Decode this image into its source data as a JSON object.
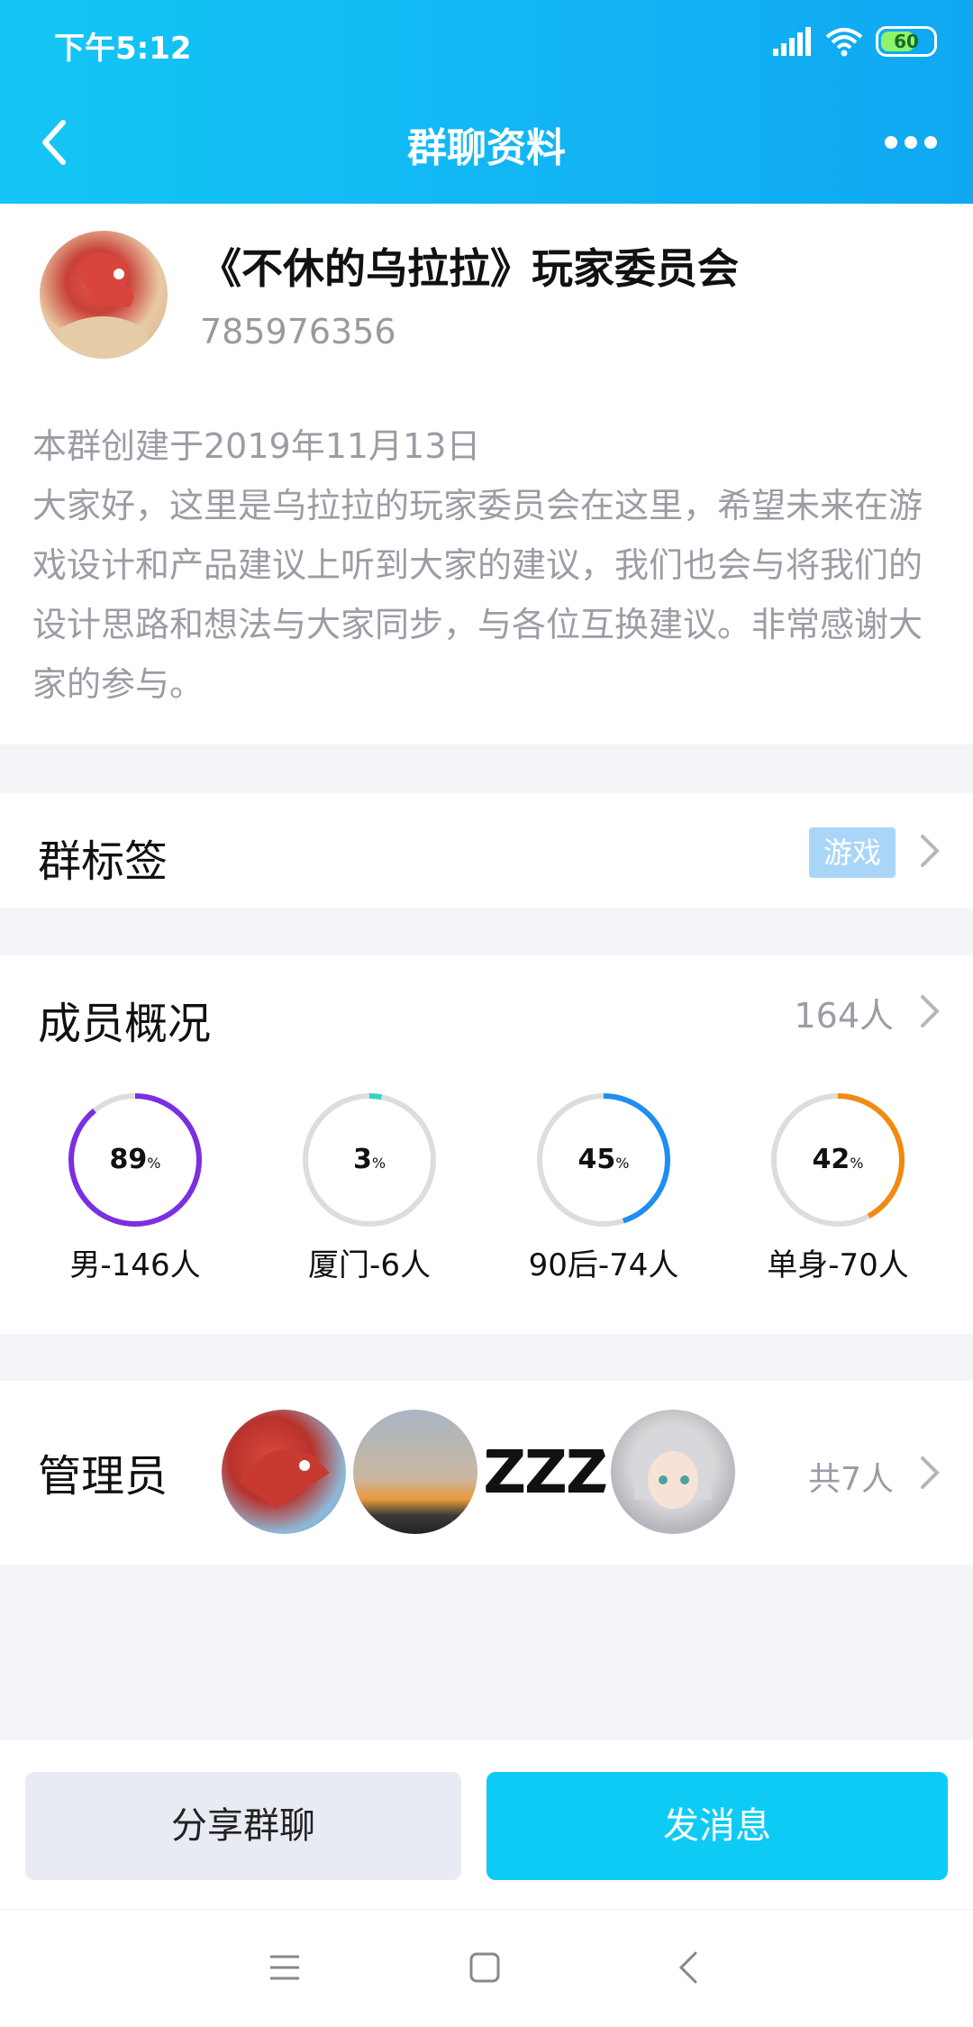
{
  "status_bar": {
    "time": "下午5:12",
    "battery": "60"
  },
  "header": {
    "title": "群聊资料"
  },
  "group": {
    "name": "《不休的乌拉拉》玩家委员会",
    "id": "785976356",
    "description": "本群创建于2019年11月13日\n大家好，这里是乌拉拉的玩家委员会在这里，希望未来在游戏设计和产品建议上听到大家的建议，我们也会与将我们的设计思路和想法与大家同步，与各位互换建议。非常感谢大家的参与。"
  },
  "tags": {
    "label": "群标签",
    "value": "游戏"
  },
  "members": {
    "label": "成员概况",
    "count": "164人",
    "stats": [
      {
        "pct": "89",
        "pct_unit": "%",
        "label": "男-146人",
        "value": 0.89,
        "color": "#7b2fe0"
      },
      {
        "pct": "3",
        "pct_unit": "%",
        "label": "厦门-6人",
        "value": 0.03,
        "color": "#2fd6c0"
      },
      {
        "pct": "45",
        "pct_unit": "%",
        "label": "90后-74人",
        "value": 0.45,
        "color": "#1e8ef0"
      },
      {
        "pct": "42",
        "pct_unit": "%",
        "label": "单身-70人",
        "value": 0.42,
        "color": "#f08a12"
      }
    ]
  },
  "admins": {
    "label": "管理员",
    "count": "共7人",
    "avatar_text": "ZZZ"
  },
  "actions": {
    "share": "分享群聊",
    "send": "发消息"
  }
}
